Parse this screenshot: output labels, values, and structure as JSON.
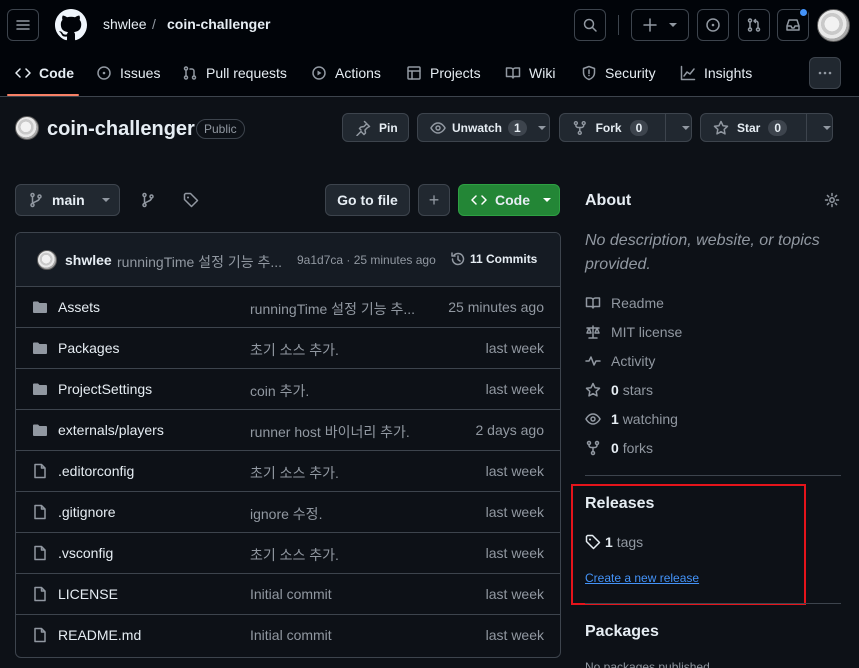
{
  "header": {
    "owner": "shwlee",
    "separator": "/",
    "repo": "coin-challenger"
  },
  "nav": {
    "tabs": [
      {
        "label": "Code",
        "icon": "code-icon"
      },
      {
        "label": "Issues",
        "icon": "issue-icon"
      },
      {
        "label": "Pull requests",
        "icon": "pull-request-icon"
      },
      {
        "label": "Actions",
        "icon": "play-icon"
      },
      {
        "label": "Projects",
        "icon": "table-icon"
      },
      {
        "label": "Wiki",
        "icon": "book-icon"
      },
      {
        "label": "Security",
        "icon": "shield-icon"
      },
      {
        "label": "Insights",
        "icon": "graph-icon"
      }
    ]
  },
  "repo": {
    "name": "coin-challenger",
    "visibility": "Public",
    "pin_label": "Pin",
    "watch_label": "Unwatch",
    "watch_count": "1",
    "fork_label": "Fork",
    "fork_count": "0",
    "star_label": "Star",
    "star_count": "0"
  },
  "toolbar": {
    "branch": "main",
    "go_to_file": "Go to file",
    "add": "+",
    "code_label": "Code"
  },
  "latest_commit": {
    "author": "shwlee",
    "message": "runningTime 설정 기능 추...",
    "hash_time": "9a1d7ca · 25 minutes ago",
    "commits_count": "11 Commits"
  },
  "files": [
    {
      "name": "Assets",
      "type": "folder",
      "message": "runningTime 설정 기능 추...",
      "time": "25 minutes ago"
    },
    {
      "name": "Packages",
      "type": "folder",
      "message": "초기 소스 추가.",
      "time": "last week"
    },
    {
      "name": "ProjectSettings",
      "type": "folder",
      "message": "coin 추가.",
      "time": "last week"
    },
    {
      "name": "externals/players",
      "type": "folder",
      "message": "runner host 바이너리 추가.",
      "time": "2 days ago"
    },
    {
      "name": ".editorconfig",
      "type": "file",
      "message": "초기 소스 추가.",
      "time": "last week"
    },
    {
      "name": ".gitignore",
      "type": "file",
      "message": "ignore 수정.",
      "time": "last week"
    },
    {
      "name": ".vsconfig",
      "type": "file",
      "message": "초기 소스 추가.",
      "time": "last week"
    },
    {
      "name": "LICENSE",
      "type": "file",
      "message": "Initial commit",
      "time": "last week"
    },
    {
      "name": "README.md",
      "type": "file",
      "message": "Initial commit",
      "time": "last week"
    }
  ],
  "about": {
    "title": "About",
    "description": "No description, website, or topics provided.",
    "readme": "Readme",
    "license": "MIT license",
    "activity": "Activity",
    "stars_count": "0",
    "stars_label": "stars",
    "watching_count": "1",
    "watching_label": "watching",
    "forks_count": "0",
    "forks_label": "forks"
  },
  "releases": {
    "title": "Releases",
    "tags_count": "1",
    "tags_label": "tags",
    "create_link": "Create a new release"
  },
  "packages": {
    "title": "Packages",
    "text": "No packages published"
  },
  "colors": {
    "background": "#0d1117",
    "header": "#010409",
    "border": "#3d444d",
    "accent_underline": "#f78166",
    "code_button": "#238636",
    "link": "#4493f8",
    "highlight_box": "#e5141b"
  }
}
